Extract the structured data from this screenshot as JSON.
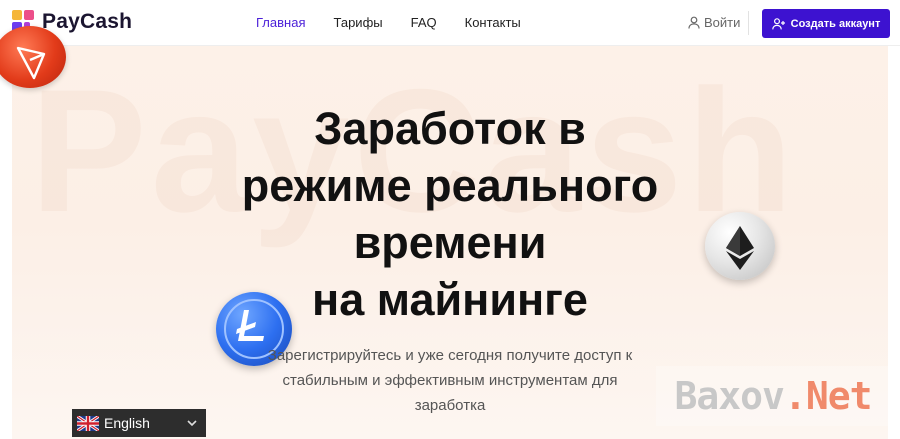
{
  "brand": {
    "name": "PayCash",
    "watermark": "PayCash"
  },
  "nav": {
    "items": [
      {
        "label": "Главная",
        "active": true
      },
      {
        "label": "Тарифы",
        "active": false
      },
      {
        "label": "FAQ",
        "active": false
      },
      {
        "label": "Контакты",
        "active": false
      }
    ]
  },
  "header": {
    "login_label": "Войти",
    "cta_label": "Создать аккаунт"
  },
  "hero": {
    "title_lines": [
      "Заработок в",
      "режиме реального",
      "времени",
      "на майнинге"
    ],
    "subtitle_lines": [
      "Зарегистрируйтесь и уже сегодня получите доступ к",
      "стабильным и эффективным инструментам для",
      "заработка"
    ]
  },
  "language": {
    "selected": "English"
  },
  "overlay_watermark": {
    "part1": "Baxov",
    "part2": ".Net"
  },
  "colors": {
    "accent": "#3d12d0",
    "nav_active": "#4b1fd8",
    "hero_bg": "#fdf1e8"
  },
  "icons": {
    "tron": "tron-coin-icon",
    "ethereum": "ethereum-coin-icon",
    "litecoin": "litecoin-coin-icon",
    "user": "user-icon",
    "user_add": "user-add-icon",
    "flag": "uk-flag-icon",
    "caret": "chevron-down-icon"
  }
}
